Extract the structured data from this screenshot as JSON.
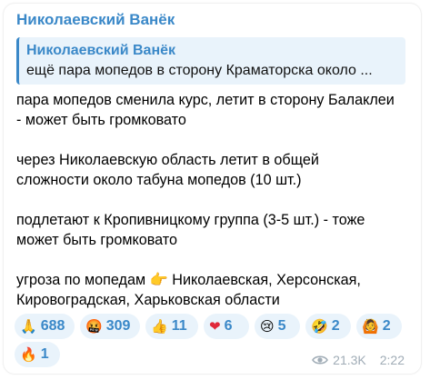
{
  "message": {
    "sender": "Николаевский Ванёк",
    "reply": {
      "name": "Николаевский Ванёк",
      "text": "ещё пара мопедов в сторону Краматорска  около ..."
    },
    "paragraphs": [
      {
        "lines": [
          "пара мопедов сменила курс, летит в сторону Балаклеи",
          "- может быть громковато"
        ]
      },
      {
        "lines": [
          "через Николаевскую область летит в общей",
          "сложности около табуна мопедов (10 шт.)"
        ]
      },
      {
        "lines": [
          "подлетают к Кропивницкому группа (3-5 шт.) - тоже",
          "может быть громковато"
        ]
      },
      {
        "lines": [
          "угроза по мопедам 👉 Николаевская, Херсонская,",
          "Кировоградская, Харьковская области"
        ]
      }
    ],
    "reactions": [
      {
        "emoji": "🙏",
        "count": "688"
      },
      {
        "emoji": "🤬",
        "count": "309"
      },
      {
        "emoji": "👍",
        "count": "11"
      },
      {
        "emoji": "❤",
        "count": "6"
      },
      {
        "emoji": "😢",
        "count": "5"
      },
      {
        "emoji": "🤣",
        "count": "2"
      },
      {
        "emoji": "🙆",
        "count": "2"
      },
      {
        "emoji": "🔥",
        "count": "1"
      }
    ],
    "views": "21.3K",
    "time": "2:22"
  },
  "colors": {
    "accent": "#3a88c8",
    "reaction_bg": "#e9f3fb",
    "meta": "#a0acb6"
  },
  "icons": {
    "views": "eye-icon"
  }
}
